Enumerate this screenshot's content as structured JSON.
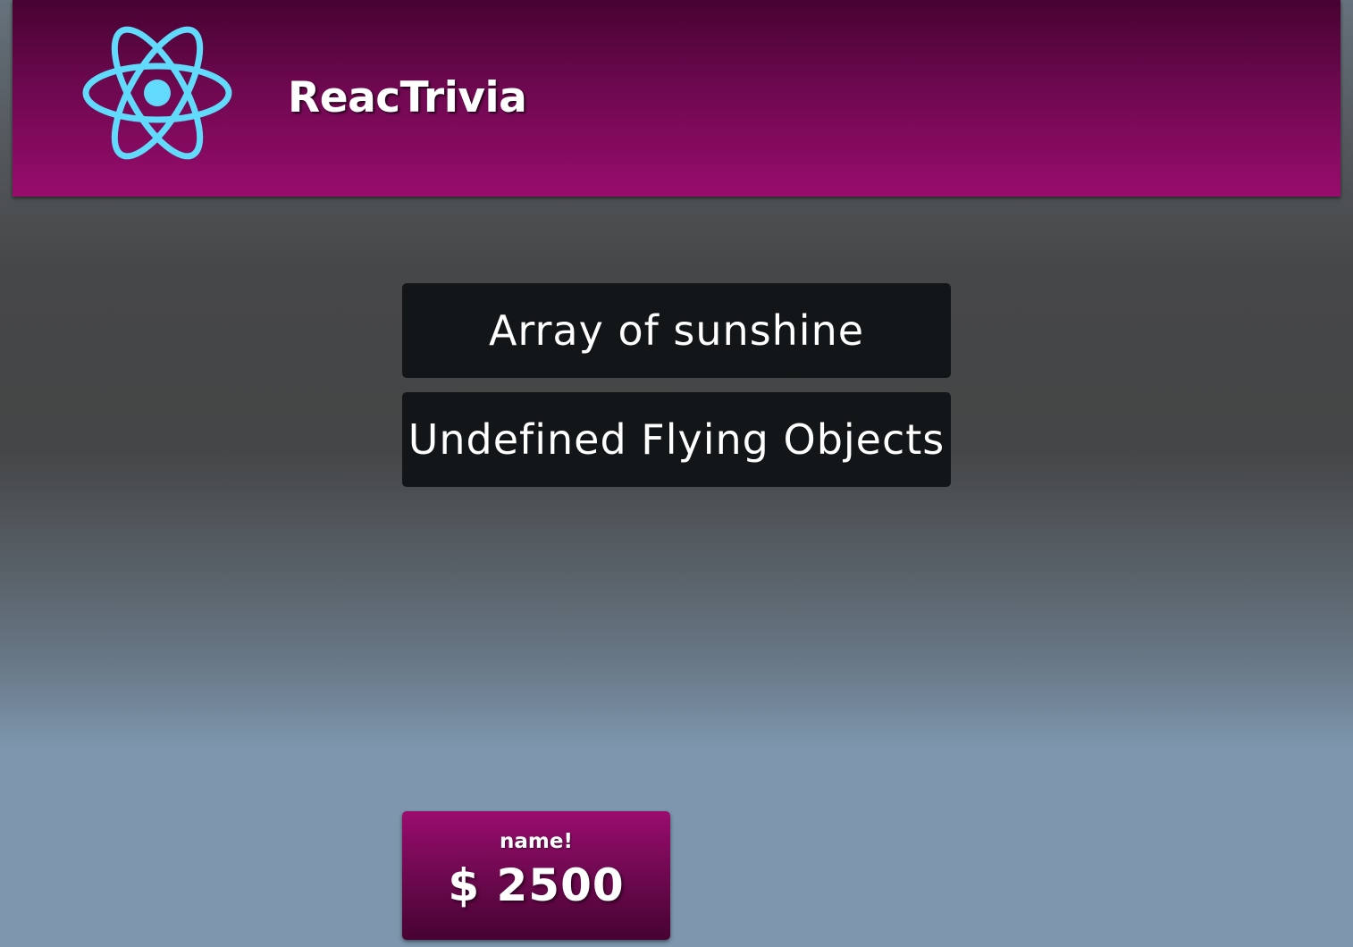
{
  "header": {
    "logo_icon": "react-atom-icon",
    "title": "ReacTrivia",
    "accent_color": "#980c6c",
    "logo_color": "#61dafb"
  },
  "answers": [
    {
      "label": "Array of sunshine"
    },
    {
      "label": "Undefined Flying Objects"
    }
  ],
  "player": {
    "name": "name!",
    "score": "$ 2500"
  }
}
